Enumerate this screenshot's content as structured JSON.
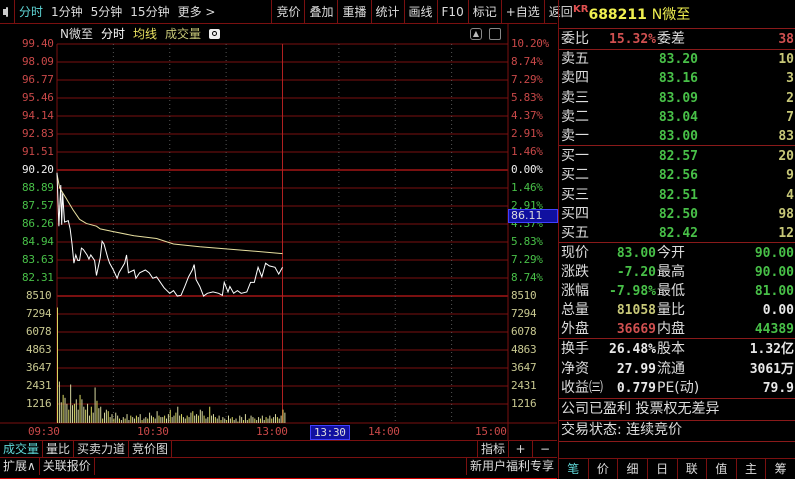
{
  "toolbar": {
    "items": [
      "分时",
      "1分钟",
      "5分钟",
      "15分钟",
      "更多 >",
      "竞价",
      "叠加",
      "重播",
      "统计",
      "画线",
      "F10",
      "标记",
      "+自选",
      "返回"
    ]
  },
  "chart": {
    "title_name": "N微至",
    "title_mode": "分时",
    "title_avg": "均线",
    "title_vol": "成交量",
    "left_labels": [
      {
        "t": "99.40",
        "c": "up"
      },
      {
        "t": "98.09",
        "c": "up"
      },
      {
        "t": "96.77",
        "c": "up"
      },
      {
        "t": "95.46",
        "c": "up"
      },
      {
        "t": "94.14",
        "c": "up"
      },
      {
        "t": "92.83",
        "c": "up"
      },
      {
        "t": "91.51",
        "c": "up"
      },
      {
        "t": "90.20",
        "c": "flat"
      },
      {
        "t": "88.89",
        "c": "down"
      },
      {
        "t": "87.57",
        "c": "down"
      },
      {
        "t": "86.26",
        "c": "down"
      },
      {
        "t": "84.94",
        "c": "down"
      },
      {
        "t": "83.63",
        "c": "down"
      },
      {
        "t": "82.31",
        "c": "down"
      },
      {
        "t": "8510",
        "c": "vol"
      },
      {
        "t": "7294",
        "c": "vol"
      },
      {
        "t": "6078",
        "c": "vol"
      },
      {
        "t": "4863",
        "c": "vol"
      },
      {
        "t": "3647",
        "c": "vol"
      },
      {
        "t": "2431",
        "c": "vol"
      },
      {
        "t": "1216",
        "c": "vol"
      }
    ],
    "right_labels": [
      {
        "t": "10.20%",
        "c": "up"
      },
      {
        "t": "8.74%",
        "c": "up"
      },
      {
        "t": "7.29%",
        "c": "up"
      },
      {
        "t": "5.83%",
        "c": "up"
      },
      {
        "t": "4.37%",
        "c": "up"
      },
      {
        "t": "2.91%",
        "c": "up"
      },
      {
        "t": "1.46%",
        "c": "up"
      },
      {
        "t": "0.00%",
        "c": "flat"
      },
      {
        "t": "1.46%",
        "c": "down"
      },
      {
        "t": "2.91%",
        "c": "down"
      },
      {
        "t": "4.37%",
        "c": "down"
      },
      {
        "t": "5.83%",
        "c": "down"
      },
      {
        "t": "7.29%",
        "c": "down"
      },
      {
        "t": "8.74%",
        "c": "down"
      },
      {
        "t": "8510",
        "c": "vol"
      },
      {
        "t": "7294",
        "c": "vol"
      },
      {
        "t": "6078",
        "c": "vol"
      },
      {
        "t": "4863",
        "c": "vol"
      },
      {
        "t": "3647",
        "c": "vol"
      },
      {
        "t": "2431",
        "c": "vol"
      },
      {
        "t": "1216",
        "c": "vol"
      }
    ],
    "cursor_price": "86.11",
    "time_labels": [
      "09:30",
      "10:30",
      "13:00",
      "13:30",
      "14:00",
      "15:00"
    ],
    "prev_close": 90.2,
    "price_min": [
      0,
      1,
      2,
      2.5,
      3,
      4,
      6,
      7,
      8,
      9,
      10,
      11,
      12,
      13,
      14,
      16,
      17,
      18,
      20,
      21,
      23,
      24,
      25,
      27,
      28,
      30,
      32,
      33,
      36,
      37,
      38,
      41,
      42,
      44,
      47,
      49,
      51,
      53,
      55,
      57,
      60,
      62,
      64,
      66,
      68,
      70,
      72,
      73,
      74,
      76,
      78,
      80,
      83,
      86,
      88,
      89,
      91,
      92,
      94,
      96,
      98,
      101,
      103,
      105,
      107,
      109,
      111,
      113,
      116,
      118,
      120
    ],
    "price": [
      90.0,
      86.1,
      89.1,
      86.2,
      88.5,
      86.4,
      86.5,
      85.9,
      84.8,
      83.4,
      84.0,
      83.6,
      83.6,
      84.5,
      84.4,
      84.0,
      83.7,
      84.0,
      83.6,
      82.5,
      83.8,
      85.0,
      84.8,
      83.8,
      83.4,
      82.9,
      82.3,
      82.7,
      83.4,
      84.0,
      82.7,
      82.9,
      82.3,
      82.7,
      82.9,
      82.7,
      82.3,
      82.4,
      82.0,
      81.6,
      81.2,
      81.4,
      81.0,
      81.05,
      81.7,
      82.4,
      82.9,
      83.3,
      82.2,
      81.7,
      81.0,
      81.2,
      81.3,
      81.2,
      81.05,
      82.0,
      81.3,
      81.7,
      81.2,
      81.4,
      81.2,
      81.3,
      82.0,
      82.0,
      83.1,
      82.4,
      83.4,
      83.2,
      83.1,
      82.6,
      83.1
    ],
    "avg_min": [
      0,
      1.4,
      5,
      8.5,
      12,
      15.6,
      21,
      23,
      30,
      41,
      53,
      62,
      76,
      94,
      120
    ],
    "avg": [
      89.9,
      88.9,
      88.1,
      87.3,
      86.6,
      86.3,
      86.1,
      85.9,
      85.7,
      85.4,
      85.2,
      84.8,
      84.6,
      84.4,
      84.1
    ],
    "volume": [
      7800,
      2800,
      1400,
      1900,
      1700,
      1300,
      900,
      2600,
      1200,
      1300,
      1600,
      900,
      1900,
      1600,
      1100,
      900,
      1300,
      500,
      1100,
      700,
      2400,
      1500,
      1000,
      1100,
      300,
      700,
      900,
      800,
      400,
      600,
      300,
      700,
      500,
      300,
      200,
      400,
      300,
      600,
      200,
      500,
      400,
      300,
      500,
      400,
      600,
      200,
      300,
      400,
      300,
      700,
      500,
      400,
      300,
      800,
      500,
      400,
      400,
      500,
      300,
      600,
      900,
      400,
      500,
      700,
      1100,
      500,
      600,
      400,
      300,
      500,
      400,
      700,
      800,
      500,
      600,
      500,
      900,
      800,
      500,
      300,
      400,
      1100,
      500,
      600,
      400,
      300,
      500,
      200,
      400,
      300,
      200,
      500,
      300,
      400,
      200,
      300,
      100,
      500,
      400,
      200,
      600,
      200,
      300,
      500,
      400,
      300,
      200,
      400,
      300,
      500,
      200,
      400,
      300,
      500,
      300,
      400,
      600,
      400,
      300,
      500,
      900,
      700
    ],
    "up_color": "#c84848",
    "down_color": "#48c048",
    "price_line_color": "#ffffff",
    "avg_line_color": "#e8e0a0",
    "grid_color": "#7a1010"
  },
  "bottom_tabs": {
    "items": [
      "成交量",
      "量比",
      "买卖力道",
      "竞价图"
    ],
    "indicator": "指标",
    "plus": "+",
    "minus": "−"
  },
  "status_bar": {
    "expand": "扩展∧",
    "related": "关联报价",
    "promo": "新用户福利专享"
  },
  "quote": {
    "prefix": "KR",
    "code": "688211",
    "name": "N微至",
    "weibi_label": "委比",
    "weibi": "15.32%",
    "weicha_label": "委差",
    "weicha": "38",
    "asks": [
      {
        "l": "卖五",
        "p": "83.20",
        "v": "10"
      },
      {
        "l": "卖四",
        "p": "83.16",
        "v": "3"
      },
      {
        "l": "卖三",
        "p": "83.09",
        "v": "2"
      },
      {
        "l": "卖二",
        "p": "83.04",
        "v": "7"
      },
      {
        "l": "卖一",
        "p": "83.00",
        "v": "83"
      }
    ],
    "bids": [
      {
        "l": "买一",
        "p": "82.57",
        "v": "20"
      },
      {
        "l": "买二",
        "p": "82.56",
        "v": "9"
      },
      {
        "l": "买三",
        "p": "82.51",
        "v": "4"
      },
      {
        "l": "买四",
        "p": "82.50",
        "v": "98"
      },
      {
        "l": "买五",
        "p": "82.42",
        "v": "12"
      }
    ],
    "stats": [
      {
        "k": "现价",
        "v": "83.00",
        "vc": "grn",
        "k2": "今开",
        "v2": "90.00",
        "v2c": "grn"
      },
      {
        "k": "涨跌",
        "v": "-7.20",
        "vc": "grn",
        "k2": "最高",
        "v2": "90.00",
        "v2c": "grn"
      },
      {
        "k": "涨幅",
        "v": "-7.98%",
        "vc": "grn",
        "k2": "最低",
        "v2": "81.00",
        "v2c": "grn"
      },
      {
        "k": "总量",
        "v": "81058",
        "vc": "yel",
        "k2": "量比",
        "v2": "0.00",
        "v2c": "wht"
      },
      {
        "k": "外盘",
        "v": "36669",
        "vc": "red",
        "k2": "内盘",
        "v2": "44389",
        "v2c": "grn"
      }
    ],
    "fin": [
      {
        "k": "换手",
        "v": "26.48%",
        "k2": "股本",
        "v2": "1.32亿"
      },
      {
        "k": "净资",
        "v": "27.99",
        "k2": "流通",
        "v2": "3061万"
      },
      {
        "k": "收益㈢",
        "v": "0.779",
        "k2": "PE(动)",
        "v2": "79.9"
      }
    ],
    "note": "公司已盈利 投票权无差异",
    "trade_status": "交易状态: 连续竞价",
    "tabs": [
      "笔",
      "价",
      "细",
      "日",
      "联",
      "值",
      "主",
      "筹"
    ]
  }
}
